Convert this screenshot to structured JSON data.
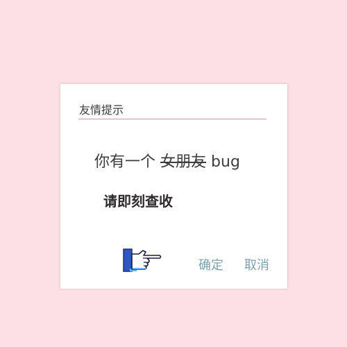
{
  "dialog": {
    "title": "友情提示",
    "message_prefix": "你有一个",
    "message_struck": "女朋友",
    "message_suffix": "bug",
    "sub_message": "请即刻查收",
    "confirm_label": "确定",
    "cancel_label": "取消",
    "pointer_icon": "pointing-hand-icon"
  },
  "colors": {
    "background": "#fbe0e6",
    "dialog": "#ffffff",
    "divider": "#c69ca4",
    "button_text": "#7ea0ae",
    "hand_cuff": "#2f57c4"
  }
}
